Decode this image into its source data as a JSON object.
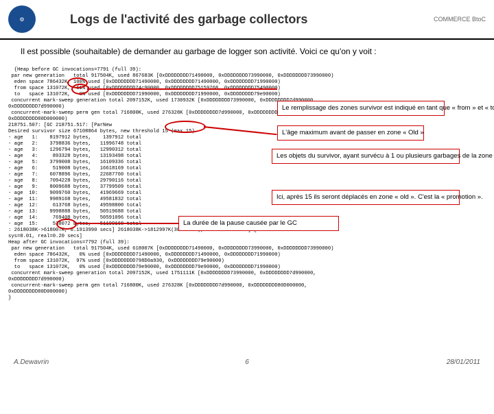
{
  "header": {
    "title": "Logs de l'activité des garbage collectors",
    "logo_right": "COMMERCE BtoC"
  },
  "intro": "Il est possible (souhaitable) de demander au garbage de logger son activité. Voici ce qu'on y voit :",
  "log": "{Heap before GC invocations=7791 (full 39):\n par new generation   total 917504K, used 867683K [0xDDDDDDDD71490000, 0xDDDDDDDD73990000, 0xDDDDDDDD73990000)\n  eden space 786432K, 100% used [0xDDDDDDDD71490000, 0xDDDDDDDD71490000, 0xDDDDDDDD71990000)\n  from space 131072K,  61% used [0xDDDDDDDD74c90000, 0xDDDDDDDD75159768, 0xDDDDDDDD75490000)\n  to   space 131072K,   0% used [0xDDDDDDDD71990000, 0xDDDDDDDD71990000, 0xDDDDDDDD79e90000)\n concurrent mark-sweep generation total 2097152K, used 1730932K [0xDDDDDDDD73990000, 0xDDDDDDDD7d990000,\n0xDDDDDDDD7d990000)\n concurrent-mark-sweep perm gen total 716800K, used 276328K [0xDDDDDDDD7d990000, 0xDDDDDDDD80D000000,\n0xDDDDDDDD80D000000)\n218751.507: [GC 218751.517: [ParNew\nDesired survivor size 67108864 bytes, new threshold 15 (max 15)\n- age   1:    8197912 bytes,    1397912 total\n- age   2:    3798836 bytes,   11996748 total\n- age   3:    1296794 bytes,   12990312 total\n- age   4:     893328 bytes,   13193498 total\n- age   5:    3799008 bytes,   16109336 total\n- age   6:     519008 bytes,   16618169 total\n- age   7:    6078896 bytes,   22687760 total\n- age   8:    7094228 bytes,   29790116 total\n- age   9:    8009688 bytes,   37799509 total\n- age  10:    9099760 bytes,   41969669 total\n- age  11:    9989168 bytes,   49581832 total\n- age  12:     613768 bytes,   49598800 total\n- age  13:    9998888 bytes,   50519688 total\n- age  14:     769408 bytes,   50591096 total\n- age  15:     538072 bytes,   51199168 total\n: 2618038K->618007K, 0.1913990 secs] 2618038K->1812997K(3019688K), 0.1925990 secs] [Times: user=0.55\nsys=0.01, real=0.20 secs]\nHeap after GC invocations=7792 (full 39):\n par new generation   total 917504K, used 618007K [0xDDDDDDDD71490000, 0xDDDDDDDD73990000, 0xDDDDDDDD73990000)\n  eden space 786432K,   0% used [0xDDDDDDDD71490000, 0xDDDDDDDD71490000, 0xDDDDDDDD71990000)\n  from space 131072K,  97% used [0xDDDDDDDD798D0a930, 0xDDDDDDDD79e90000)\n  to   space 131072K,   0% used [0xDDDDDDDD79e90000, 0xDDDDDDDD79e90000, 0xDDDDDDDD71990000)\n concurrent mark-sweep generation total 2097152K, used 1751111K [0xDDDDDDDD73990000, 0xDDDDDDDD7d990000,\n0xDDDDDDDD7d990000)\n concurrent-mark-sweep perm gen total 716800K, used 276328K [0xDDDDDDDD7d990000, 0xDDDDDDDD80D000000,\n0xDDDDDDDD80D000000)\n}",
  "annotations": {
    "survivor": "Le remplissage des zones survivor est indiqué en tant que « from » et « to »",
    "max_age": "L'âge maximum avant de passer en zone « Old »",
    "objets": "Les objets du survivor, ayant survécu à 1 ou plusieurs garbages de la zone « new », peuvent être indiqués sur demande dans le log gc (paramètre printTenuringDistribution).",
    "promotion": "Ici, après 15 ils seront déplacés en zone « old ». C'est la « promotion ».",
    "pause": "La durée de la pause causée par le GC"
  },
  "footer": {
    "author": "A.Dewavrin",
    "page": "6",
    "date": "28/01/2011"
  }
}
